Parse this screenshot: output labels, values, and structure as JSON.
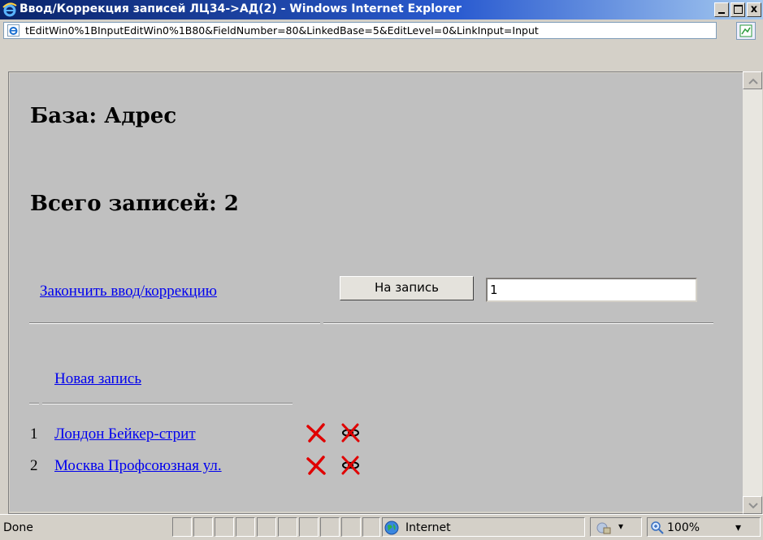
{
  "window": {
    "title": "Ввод/Коррекция записей ЛЦ34->АД(2) - Windows Internet Explorer",
    "close_glyph": "x"
  },
  "address": {
    "url": "tEditWin0%1BInputEditWin0%1B80&FieldNumber=80&LinkedBase=5&EditLevel=0&LinkInput=Input"
  },
  "page": {
    "base_heading": "База: Адрес",
    "count_heading": "Всего записей: 2",
    "finish_link": "Закончить ввод/коррекцию ",
    "goto_button": "На запись",
    "goto_value": "1",
    "new_record_link": "Новая запись",
    "records": [
      {
        "num": "1",
        "label": "Лондон Бейкер-стрит"
      },
      {
        "num": "2",
        "label": "Москва Профсоюзная ул."
      }
    ]
  },
  "statusbar": {
    "text": "Done",
    "zone": "Internet",
    "zoom": "100%",
    "dropdown_glyph": "▾"
  },
  "icons": {
    "browser": "ie-logo-icon",
    "page": "ie-page-icon",
    "delete": "delete-x-icon",
    "unlink": "unlink-icon",
    "zone": "globe-icon",
    "zoom": "magnifier-icon",
    "protected": "lock-icon"
  },
  "colors": {
    "titlebar": "#0a246a",
    "link": "#0000ee",
    "delete_icon": "#e00000",
    "background": "#c0c0c0"
  }
}
